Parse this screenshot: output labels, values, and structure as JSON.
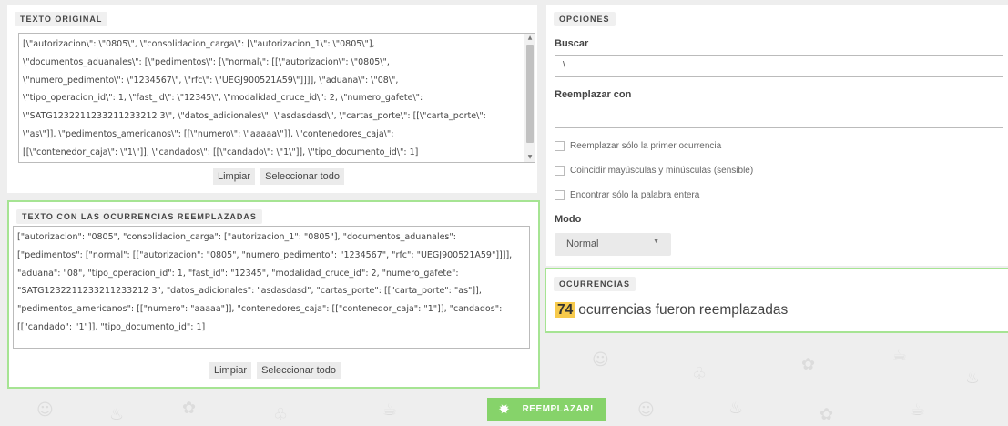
{
  "original": {
    "title": "TEXTO ORIGINAL",
    "lines": [
      "[\\\"autorizacion\\\": \\\"0805\\\", \\\"consolidacion_carga\\\": [\\\"autorizacion_1\\\": \\\"0805\\\"],",
      "\\\"documentos_aduanales\\\": [\\\"pedimentos\\\": [\\\"normal\\\": [[\\\"autorizacion\\\": \\\"0805\\\",",
      "\\\"numero_pedimento\\\": \\\"1234567\\\", \\\"rfc\\\": \\\"UEGJ900521A59\\\"]]]], \\\"aduana\\\": \\\"08\\\",",
      "\\\"tipo_operacion_id\\\": 1, \\\"fast_id\\\": \\\"12345\\\", \\\"modalidad_cruce_id\\\": 2, \\\"numero_gafete\\\":",
      "\\\"SATG1232211233211233212 3\\\", \\\"datos_adicionales\\\": \\\"asdasdasd\\\", \\\"cartas_porte\\\": [[\\\"carta_porte\\\":",
      "\\\"as\\\"]], \\\"pedimentos_americanos\\\": [[\\\"numero\\\": \\\"aaaaa\\\"]], \\\"contenedores_caja\\\":",
      "[[\\\"contenedor_caja\\\": \\\"1\\\"]], \\\"candados\\\": [[\\\"candado\\\": \\\"1\\\"]], \\\"tipo_documento_id\\\": 1]"
    ],
    "clear_label": "Limpiar",
    "select_all_label": "Seleccionar todo"
  },
  "result": {
    "title": "TEXTO CON LAS OCURRENCIAS REEMPLAZADAS",
    "lines": [
      "[\"autorizacion\": \"0805\", \"consolidacion_carga\": [\"autorizacion_1\": \"0805\"], \"documentos_aduanales\":",
      "[\"pedimentos\": [\"normal\": [[\"autorizacion\": \"0805\", \"numero_pedimento\": \"1234567\", \"rfc\": \"UEGJ900521A59\"]]]],",
      "\"aduana\": \"08\", \"tipo_operacion_id\": 1, \"fast_id\": \"12345\", \"modalidad_cruce_id\": 2, \"numero_gafete\":",
      "\"SATG1232211233211233212 3\", \"datos_adicionales\": \"asdasdasd\", \"cartas_porte\": [[\"carta_porte\": \"as\"]],",
      "\"pedimentos_americanos\": [[\"numero\": \"aaaaa\"]], \"contenedores_caja\": [[\"contenedor_caja\": \"1\"]], \"candados\":",
      "[[\"candado\": \"1\"]], \"tipo_documento_id\": 1]"
    ],
    "clear_label": "Limpiar",
    "select_all_label": "Seleccionar todo"
  },
  "options": {
    "title": "OPCIONES",
    "search_label": "Buscar",
    "search_value": "\\",
    "replace_label": "Reemplazar con",
    "replace_value": "",
    "checks": [
      {
        "label": "Reemplazar sólo la primer ocurrencia",
        "checked": false
      },
      {
        "label": "Coincidir mayúsculas y minúsculas (sensible)",
        "checked": false
      },
      {
        "label": "Encontrar sólo la palabra entera",
        "checked": false
      }
    ],
    "mode_label": "Modo",
    "mode_value": "Normal"
  },
  "occurrences": {
    "title": "OCURRENCIAS",
    "count": "74",
    "text": "ocurrencias fueron reemplazadas"
  },
  "action": {
    "label": "REEMPLAZAR!",
    "icon": "gear-icon"
  },
  "colors": {
    "accent_green": "#86d36a",
    "border_green": "#a6e493",
    "highlight": "#f7ca4c"
  }
}
